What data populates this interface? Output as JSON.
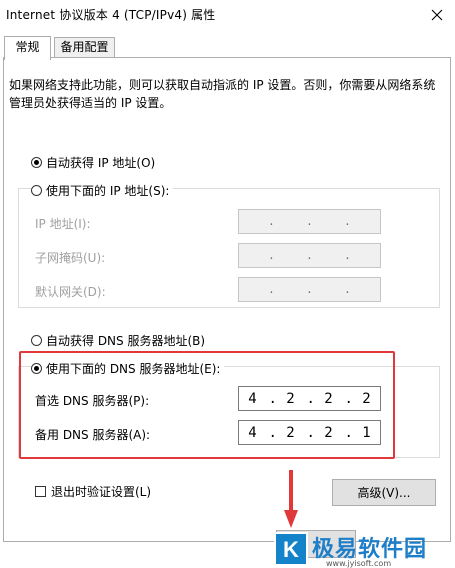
{
  "window": {
    "title": "Internet 协议版本 4 (TCP/IPv4) 属性"
  },
  "tabs": [
    {
      "label": "常规",
      "active": true
    },
    {
      "label": "备用配置",
      "active": false
    }
  ],
  "description": "如果网络支持此功能，则可以获取自动指派的 IP 设置。否则，你需要从网络系统管理员处获得适当的 IP 设置。",
  "ip": {
    "auto_label": "自动获得 IP 地址(O)",
    "auto_selected": true,
    "manual_label": "使用下面的 IP 地址(S):",
    "manual_selected": false,
    "fields": [
      {
        "label": "IP 地址(I):",
        "value": ". . ."
      },
      {
        "label": "子网掩码(U):",
        "value": ". . ."
      },
      {
        "label": "默认网关(D):",
        "value": ". . ."
      }
    ]
  },
  "dns": {
    "auto_label": "自动获得 DNS 服务器地址(B)",
    "auto_selected": false,
    "manual_label": "使用下面的 DNS 服务器地址(E):",
    "manual_selected": true,
    "preferred": {
      "label": "首选 DNS 服务器(P):",
      "octets": [
        "4",
        "2",
        "2",
        "2"
      ]
    },
    "alternate": {
      "label": "备用 DNS 服务器(A):",
      "octets": [
        "4",
        "2",
        "2",
        "1"
      ]
    }
  },
  "footer": {
    "validate_label": "退出时验证设置(L)",
    "validate_checked": false,
    "advanced_label": "高级(V)..."
  },
  "colors": {
    "highlight": "#e1383c",
    "watermark": "#1e7fc8"
  },
  "watermark": {
    "text": "极易软件园",
    "sub": "www.jyisoft.com",
    "logo": "K"
  }
}
